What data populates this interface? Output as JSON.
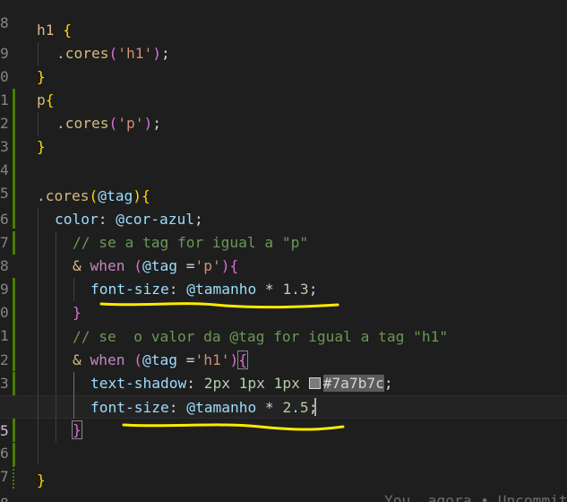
{
  "editor": {
    "line_numbers": [
      "8",
      "9",
      "0",
      "1",
      "2",
      "3",
      "4",
      "5",
      "6",
      "7",
      "8",
      "9",
      "0",
      "1",
      "2",
      "3",
      "4",
      "5",
      "6",
      "7",
      "8"
    ],
    "lines": {
      "l9": {
        "sel": "h1",
        "sp": " ",
        "open": "{"
      },
      "l10": {
        "sel": ".cores",
        "p1": "(",
        "str": "'h1'",
        "p2": ")",
        "semi": ";"
      },
      "l11": {
        "close": "}"
      },
      "l12": {
        "sel": "p",
        "open": "{"
      },
      "l13": {
        "sel": ".cores",
        "p1": "(",
        "str": "'p'",
        "p2": ")",
        "semi": ";"
      },
      "l14": {
        "close": "}"
      },
      "l16": {
        "sel": ".cores",
        "p1": "(",
        "var": "@tag",
        "p2": ")",
        "open": "{"
      },
      "l17": {
        "prop": "color",
        "colon": ": ",
        "var": "@cor-azul",
        "semi": ";"
      },
      "l18": {
        "comment": "// se a tag for igual a \"p\""
      },
      "l19": {
        "amp": "&",
        "kw": " when ",
        "p1": "(",
        "var": "@tag",
        "op": " =",
        "str": "'p'",
        "p2": ")",
        "open": "{"
      },
      "l20": {
        "prop": "font-size",
        "colon": ": ",
        "var": "@tamanho",
        "op": " * ",
        "num": "1.3",
        "semi": ";"
      },
      "l21": {
        "close": "}"
      },
      "l22": {
        "comment": "// se  o valor da @tag for igual a tag \"h1\""
      },
      "l23": {
        "amp": "&",
        "kw": " when ",
        "p1": "(",
        "var": "@tag",
        "op": " =",
        "str": "'h1'",
        "p2": ")",
        "open": "{"
      },
      "l24": {
        "prop": "text-shadow",
        "colon": ": ",
        "val": "2px 1px 1px ",
        "color": "#7a7b7c",
        "semi": ";"
      },
      "l25": {
        "prop": "font-size",
        "colon": ": ",
        "var": "@tamanho",
        "op": " * ",
        "num": "2.5",
        "semi": ";"
      },
      "l26": {
        "close": "}"
      },
      "l28": {
        "close": "}"
      }
    },
    "inline_blame": "You, agora • Uncommitted changes",
    "annotation_color": "#ffea00",
    "swatch_color": "#7a7b7c"
  }
}
